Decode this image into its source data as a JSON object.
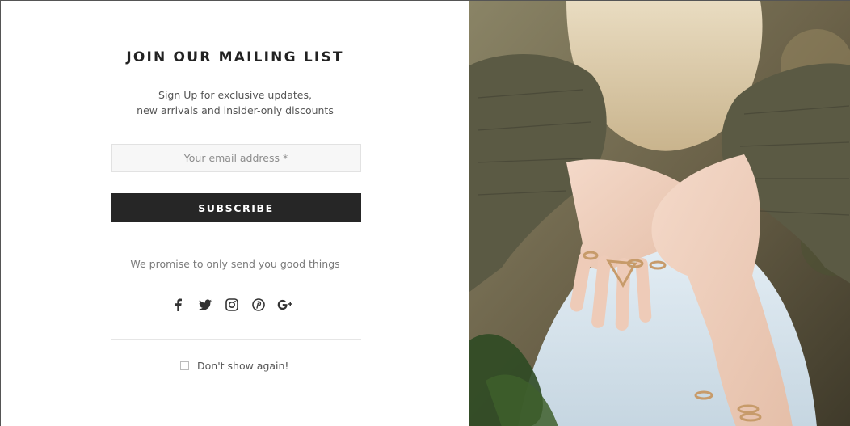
{
  "popup": {
    "title": "JOIN OUR MAILING LIST",
    "subtitle_line1": "Sign Up for exclusive updates,",
    "subtitle_line2": "new arrivals and insider-only discounts",
    "email_placeholder": "Your email address *",
    "subscribe_label": "SUBSCRIBE",
    "promise_text": "We promise to only send you good things",
    "social_icons": [
      "facebook-icon",
      "twitter-icon",
      "instagram-icon",
      "pinterest-icon",
      "google-plus-icon"
    ],
    "dont_show_label": "Don't show again!",
    "dont_show_checked": false
  },
  "colors": {
    "button_bg": "#262626",
    "title_text": "#222222",
    "input_bg": "#f7f7f7"
  }
}
